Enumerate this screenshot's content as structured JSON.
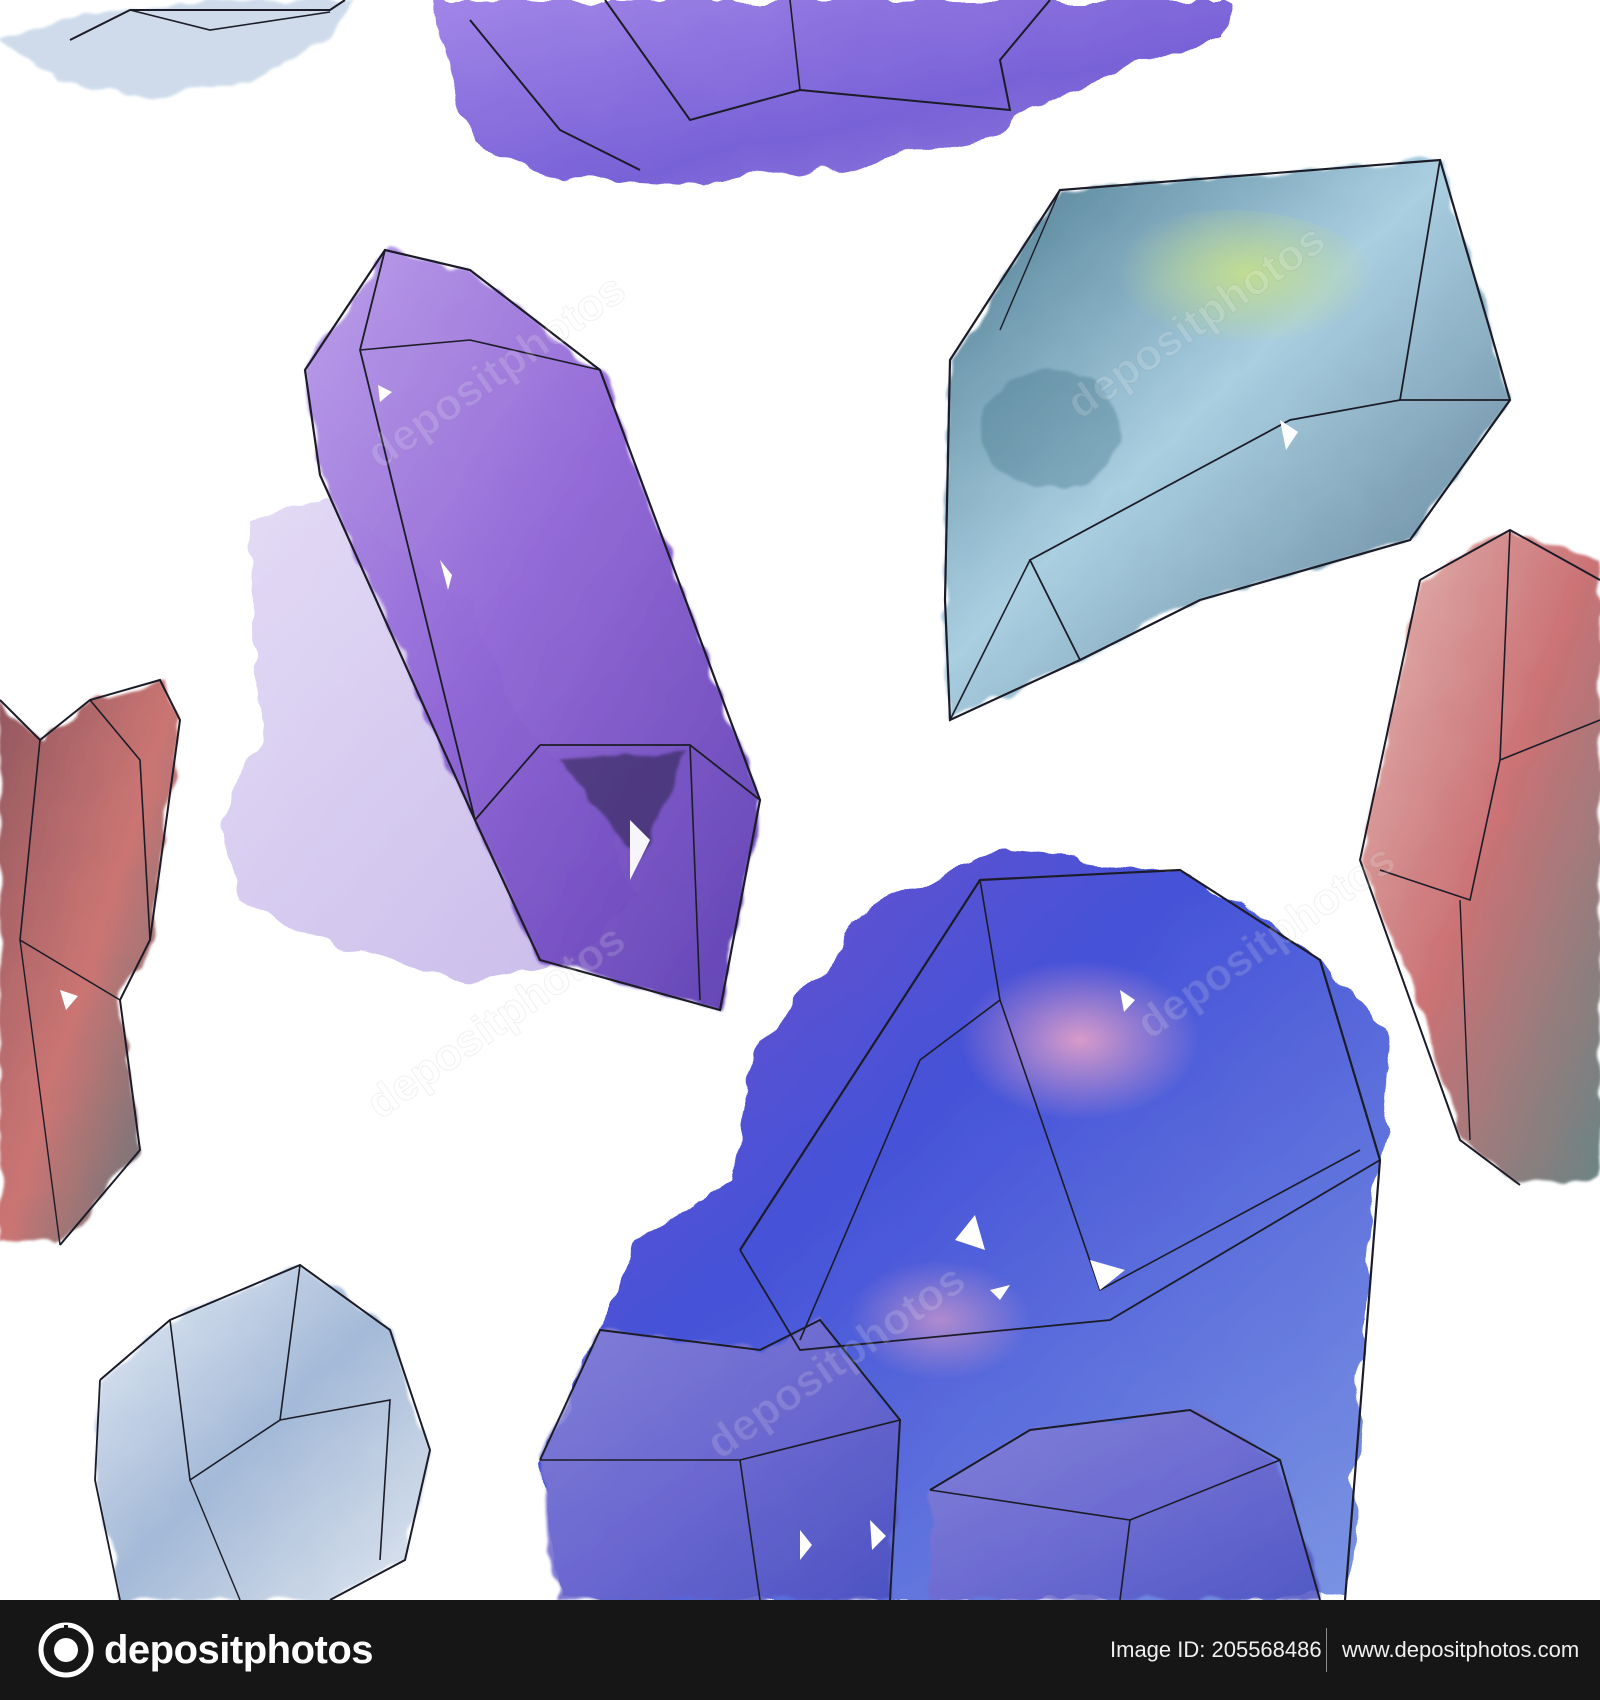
{
  "image": {
    "subject": "watercolor crystals seamless pattern",
    "palette": {
      "background": "#ffffff",
      "violet": "#8e62d6",
      "blue": "#3a4fd8",
      "teal": "#6fa6b9",
      "rose": "#c97a7c",
      "pale_blue": "#b8cde8",
      "ink": "#1c1c28",
      "footer": "#161616"
    }
  },
  "footer": {
    "brand": "depositphotos",
    "image_id_label": "Image ID: 205568486",
    "site_url": "www.depositphotos.com",
    "icon": "depositphotos-logo-icon"
  },
  "watermark": {
    "text": "depositphotos"
  }
}
